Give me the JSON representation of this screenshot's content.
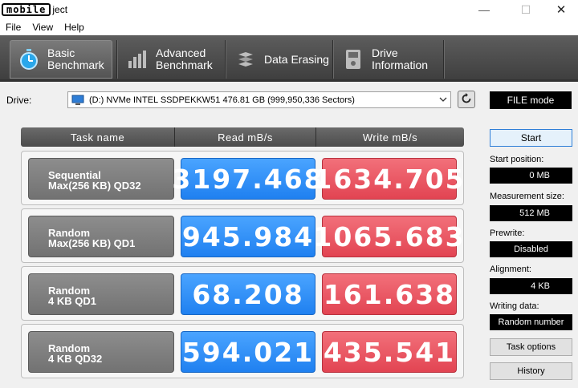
{
  "window": {
    "logo_text": "mobile",
    "title_suffix": "ject",
    "controls": {
      "minimize": "—",
      "maximize": "☐",
      "close": "✕"
    }
  },
  "menu": [
    "File",
    "View",
    "Help"
  ],
  "tabs": [
    {
      "line1": "Basic",
      "line2": "Benchmark",
      "icon": "stopwatch-icon",
      "active": true
    },
    {
      "line1": "Advanced",
      "line2": "Benchmark",
      "icon": "bar-chart-icon",
      "active": false
    },
    {
      "line1": "Data Erasing",
      "line2": "",
      "icon": "eraser-icon",
      "active": false
    },
    {
      "line1": "Drive",
      "line2": "Information",
      "icon": "drive-info-icon",
      "active": false
    }
  ],
  "drive": {
    "label": "Drive:",
    "selected": "(D:) NVMe INTEL SSDPEKKW51  476.81 GB (999,950,336 Sectors)"
  },
  "file_mode": "FILE mode",
  "table": {
    "headers": [
      "Task name",
      "Read mB/s",
      "Write mB/s"
    ],
    "rows": [
      {
        "task_line1": "Sequential",
        "task_line2": "Max(256 KB) QD32",
        "read": "3197.468",
        "write": "1634.705"
      },
      {
        "task_line1": "Random",
        "task_line2": "Max(256 KB) QD1",
        "read": "945.984",
        "write": "1065.683"
      },
      {
        "task_line1": "Random",
        "task_line2": "4 KB QD1",
        "read": "68.208",
        "write": "161.638"
      },
      {
        "task_line1": "Random",
        "task_line2": "4 KB QD32",
        "read": "594.021",
        "write": "435.541"
      }
    ]
  },
  "panel": {
    "start": "Start",
    "start_position_label": "Start position:",
    "start_position": "0 MB",
    "measurement_size_label": "Measurement size:",
    "measurement_size": "512 MB",
    "prewrite_label": "Prewrite:",
    "prewrite": "Disabled",
    "alignment_label": "Alignment:",
    "alignment": "4 KB",
    "writing_data_label": "Writing data:",
    "writing_data": "Random number",
    "task_options": "Task options",
    "history": "History"
  },
  "colors": {
    "read": "#2b8cf5",
    "write": "#e8525e",
    "tabbar": "#4d4d4d"
  }
}
